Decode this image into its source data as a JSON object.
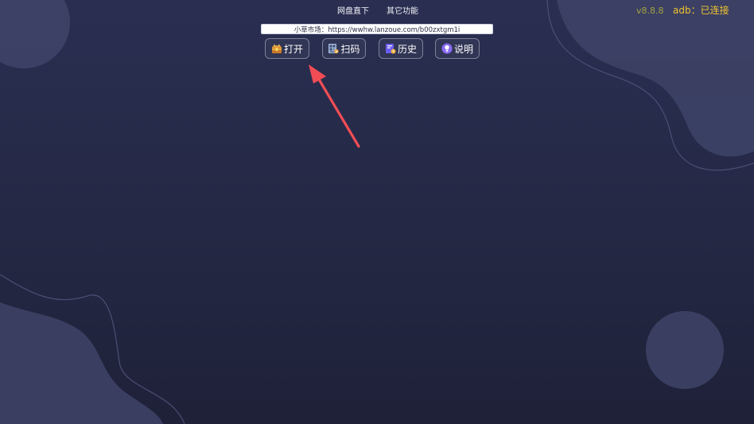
{
  "nav": {
    "items": [
      {
        "label": "网盘直下"
      },
      {
        "label": "其它功能"
      }
    ]
  },
  "header": {
    "version": "v8.8.8",
    "adb_status": "adb：已连接"
  },
  "url_input": {
    "value": "小草市场：https://wwhw.lanzoue.com/b00zxtgm1i"
  },
  "toolbar": {
    "open_label": "打开",
    "scan_label": "扫码",
    "history_label": "历史",
    "help_label": "说明"
  },
  "colors": {
    "background_top": "#2a2f52",
    "background_bottom": "#1e2138",
    "version_text": "#a3a241",
    "adb_status_text": "#f2c42f",
    "button_border": "#7d8198",
    "annotation_arrow": "#f24d55"
  },
  "icons": {
    "open": "treasure-chest-icon",
    "scan": "qr-scan-icon",
    "history": "history-clock-icon",
    "help": "lightbulb-icon"
  }
}
